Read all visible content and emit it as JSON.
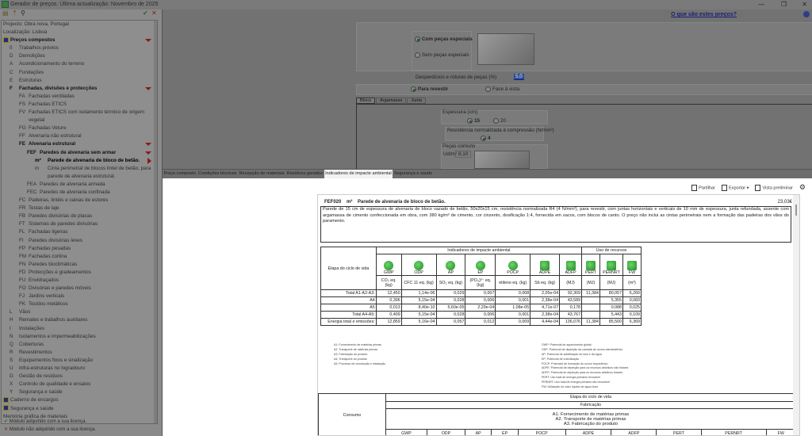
{
  "window": {
    "title": "Gerador de preços. Última actualização: Novembro de 2025",
    "help_link": "O que são estes preços?"
  },
  "sidebar": {
    "project": "Projecto: Obra nova, Portugal",
    "location": "Localização: Lisboa",
    "tree": [
      {
        "code": "",
        "label": "Preços compostos",
        "level": 0,
        "bold": true,
        "book": true,
        "marker": "down"
      },
      {
        "code": "0",
        "label": "Trabalhos prévios",
        "level": 1
      },
      {
        "code": "D",
        "label": "Demolições",
        "level": 1
      },
      {
        "code": "A",
        "label": "Acondicionamento do terreno",
        "level": 1
      },
      {
        "code": "C",
        "label": "Fundações",
        "level": 1
      },
      {
        "code": "E",
        "label": "Estruturas",
        "level": 1
      },
      {
        "code": "F",
        "label": "Fachadas, divisões e protecções",
        "level": 1,
        "bold": true,
        "marker": "down"
      },
      {
        "code": "FA",
        "label": "Fachadas ventiladas",
        "level": 2
      },
      {
        "code": "FS",
        "label": "Fachadas ETICS",
        "level": 2
      },
      {
        "code": "FV",
        "label": "Fachadas ETICS com isolamento térmico de origem",
        "level": 2
      },
      {
        "code": "",
        "label": "vegetal",
        "level": 2
      },
      {
        "code": "FG",
        "label": "Fachadas Veture",
        "level": 2
      },
      {
        "code": "FF",
        "label": "Alvenaria não estrutural",
        "level": 2
      },
      {
        "code": "FE",
        "label": "Alvenaria estrutural",
        "level": 2,
        "bold": true,
        "marker": "down"
      },
      {
        "code": "FEF",
        "label": "Paredes de alvenaria sem armar",
        "level": 3,
        "bold": true,
        "marker": "down"
      },
      {
        "code": "m²",
        "label": "Parede de alvenaria de bloco de betão.",
        "level": 4,
        "bold": true,
        "marker": "right"
      },
      {
        "code": "m",
        "label": "Cinta perimetral de blocos lintel de betão, para",
        "level": 4
      },
      {
        "code": "",
        "label": "parede de alvenaria estrutural.",
        "level": 4
      },
      {
        "code": "FEA",
        "label": "Paredes de alvenaria armada",
        "level": 3
      },
      {
        "code": "FEC",
        "label": "Paredes de alvenaria confinada",
        "level": 3
      },
      {
        "code": "FC",
        "label": "Padeiras, lintéis e caixas de estores",
        "level": 2
      },
      {
        "code": "FR",
        "label": "Testas de laje",
        "level": 2
      },
      {
        "code": "FB",
        "label": "Paredes divisórias de placas",
        "level": 2
      },
      {
        "code": "FT",
        "label": "Sistemas de paredes divisórias",
        "level": 2
      },
      {
        "code": "FL",
        "label": "Fachadas ligeiras",
        "level": 2
      },
      {
        "code": "FI",
        "label": "Paredes divisórias leves",
        "level": 2
      },
      {
        "code": "FP",
        "label": "Fachadas pesadas",
        "level": 2
      },
      {
        "code": "FM",
        "label": "Fachadas cortina",
        "level": 2
      },
      {
        "code": "FN",
        "label": "Paredes bioclimáticas",
        "level": 2
      },
      {
        "code": "FD",
        "label": "Protecções e gradeamentos",
        "level": 2
      },
      {
        "code": "FU",
        "label": "Envidraçados",
        "level": 2
      },
      {
        "code": "FO",
        "label": "Divisórias e paredes móveis",
        "level": 2
      },
      {
        "code": "FJ",
        "label": "Jardins verticais",
        "level": 2
      },
      {
        "code": "FK",
        "label": "Tecidos metálicos",
        "level": 2
      },
      {
        "code": "L",
        "label": "Vãos",
        "level": 1
      },
      {
        "code": "H",
        "label": "Remates e trabalhos auxiliares",
        "level": 1
      },
      {
        "code": "I",
        "label": "Instalações",
        "level": 1
      },
      {
        "code": "N",
        "label": "Isolamentos e impermeabilizações",
        "level": 1
      },
      {
        "code": "Q",
        "label": "Coberturas",
        "level": 1
      },
      {
        "code": "R",
        "label": "Revestimentos",
        "level": 1
      },
      {
        "code": "S",
        "label": "Equipamentos fixos e sinalização",
        "level": 1
      },
      {
        "code": "U",
        "label": "Infra-estruturas no logradouro",
        "level": 1
      },
      {
        "code": "G",
        "label": "Gestão de resíduos",
        "level": 1
      },
      {
        "code": "X",
        "label": "Controlo de qualidade e ensaios",
        "level": 1
      },
      {
        "code": "Y",
        "label": "Segurança e saúde",
        "level": 1
      },
      {
        "code": "",
        "label": "Caderno de encargos",
        "level": 0,
        "book": true
      },
      {
        "code": "",
        "label": "Segurança e saúde",
        "level": 0,
        "book": true
      },
      {
        "code": "",
        "label": "Memória gráfica de materiais",
        "level": 0
      }
    ],
    "footer": {
      "acquired": "Módulo adquirido com a sua licença.",
      "not_acquired": "Módulo não adquirido com a sua licença."
    }
  },
  "options": {
    "special_on": "Com peças especiais",
    "special_off": "Sem peças especiais",
    "waste_label": "Desperdícios e roturas de peças (%)",
    "waste_value": "5,0",
    "finish_a": "Para revestir",
    "finish_b": "Face à vista",
    "subtabs": [
      "Bloco",
      "Argamassa",
      "Junta"
    ],
    "thickness_label": "Espessura (cm)",
    "thickness_a": "15",
    "thickness_b": "20",
    "resistance_label": "Resistência normalizada à compressão (N/mm²)",
    "resistance_value": "4",
    "common_label": "Peças comuns",
    "common_unit": "Ud/m²",
    "common_value": "8,10"
  },
  "tabs": [
    "Preço composto",
    "Condições técnicas",
    "Recepção de materiais",
    "Resíduos gerados",
    "Indicadores de impacte ambiental",
    "Segurança e saúde"
  ],
  "toolbar": {
    "share": "Partilhar",
    "export": "Exportar",
    "preview": "Vista preliminar"
  },
  "doc": {
    "code": "FEF020",
    "unit": "m²",
    "title": "Parede de alvenaria de bloco de betão.",
    "price": "23,03€",
    "description": "Parede de 15 cm de espessura de alvenaria de bloco vazado de betão, 50x20x15 cm, resistência normalizada R4 (4 N/mm²), para revestir, com juntas horizontais e verticais de 10 mm de espessura, junta refundada, assente com argamassa de cimento confeccionada em obra, com 380 kg/m³ de cimento, cor cinzento, dosificação 1:4, fornecida em sacos, com blocos de canto. O preço não inclui as cintas perimetrais nem a formação das padeiras dos vãos do paramento.",
    "impact": {
      "stage_header": "Etapa do ciclo de vida",
      "group1": "Indicadores de impacte ambiental",
      "group2": "Uso de recursos",
      "indicators": [
        "GWP",
        "ODP",
        "AP",
        "EP",
        "POCP",
        "ADPE",
        "ADFP",
        "PERT",
        "PERNRT",
        "FW"
      ],
      "units": [
        "CO₂ eq. (kg)",
        "CFC 11 eq. (kg)",
        "SO₂ eq. (kg)",
        "(PO₄)³⁻ eq. (kg)",
        "etileno eq. (kg)",
        "Sb eq. (kg)",
        "(MJ)",
        "(MJ)",
        "(MJ)",
        "(m³)"
      ],
      "rows": [
        {
          "stage": "Total A1-A2-A3:",
          "values": [
            "12,450",
            "1,14e-06",
            "0,029",
            "0,007",
            "0,008",
            "2,05e-04",
            "92,309",
            "11,384",
            "80,057",
            "6,260"
          ]
        },
        {
          "stage": "A4",
          "values": [
            "0,396",
            "5,15e-04",
            "0,028",
            "0,006",
            "0,001",
            "2,38e-04",
            "43,589",
            "",
            "5,355",
            "0,083"
          ]
        },
        {
          "stage": "A5",
          "values": [
            "0,013",
            "8,40e-10",
            "5,60e-05",
            "2,29e-04",
            "1,08e-05",
            "4,71e-07",
            "0,178",
            "",
            "0,088",
            "0,025"
          ]
        },
        {
          "stage": "Total A4-A5:",
          "values": [
            "0,409",
            "5,15e-04",
            "0,028",
            "0,006",
            "0,001",
            "2,38e-04",
            "43,767",
            "",
            "5,443",
            "0,109"
          ]
        },
        {
          "stage": "Energia total e emissões:",
          "values": [
            "12,859",
            "5,16e-04",
            "0,057",
            "0,012",
            "0,009",
            "4,44e-04",
            "136,076",
            "11,384",
            "85,500",
            "6,369"
          ]
        }
      ]
    },
    "legend_stages": [
      "A1: Fornecimento de matérias primas",
      "A2: Transporte de matérias primas",
      "A3: Fabricação do produto",
      "A4: Transporte do produto",
      "A5: Processo de construção e instalação"
    ],
    "legend_indicators": [
      "GWP: Potencial de aquecimento global",
      "ODP: Potencial de depleção da camada de ozono estratosférico",
      "AP: Potencial de acidificação do solo e da água",
      "EP: Potencial de eutrofização",
      "POCP: Potencial de formação do ozono troposférico",
      "ADPE: Potencial de depleção para os recursos abióticos não fósseis",
      "ADFP: Potencial de depleção para os recursos abióticos fósseis",
      "PERT: Uso total de energia primária renovável",
      "PERNRT: Uso total de energia primária não renovável",
      "FW: Utilização do valor líquido de água doce"
    ],
    "consumption": {
      "label": "Consumo",
      "stage": "Etapa do ciclo de vida",
      "phase": "Fabricação",
      "steps": [
        "A1. Fornecimento de matérias primas",
        "A2. Transporte de matérias primas",
        "A3. Fabricação do produto"
      ]
    }
  }
}
